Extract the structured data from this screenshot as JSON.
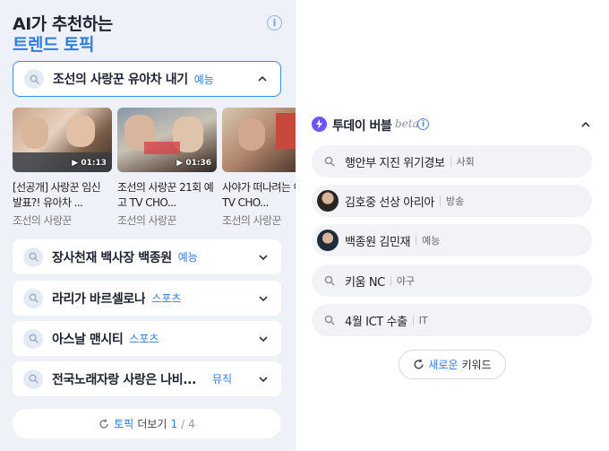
{
  "left": {
    "title_line1": "AI가 추천하는",
    "title_line2": "트렌드 토픽",
    "info_icon": "info-icon",
    "open_topic": {
      "title": "조선의 사랑꾼 유아차 내기",
      "category": "예능"
    },
    "videos": [
      {
        "duration": "01:13",
        "title": "[선공개] 사랑꾼 임신 발표?! 유아차 ...",
        "source": "조선의 사랑꾼"
      },
      {
        "duration": "01:36",
        "title": "조선의 사랑꾼 21회 예고 TV CHO...",
        "source": "조선의 사랑꾼"
      },
      {
        "duration": "",
        "title": "사야가 떠나려는 이유 TV CHO...",
        "source": "조선의 사랑꾼"
      }
    ],
    "topics": [
      {
        "title": "장사천재 백사장 백종원",
        "category": "예능"
      },
      {
        "title": "라리가 바르셀로나",
        "category": "스포츠"
      },
      {
        "title": "아스날 맨시티",
        "category": "스포츠"
      },
      {
        "title": "전국노래자랑 사랑은 나비...",
        "category": "뮤직"
      }
    ],
    "more": {
      "topic_label": "토픽",
      "more_label": "더보기",
      "page_current": "1",
      "page_sep": "/",
      "page_total": "4"
    }
  },
  "right": {
    "title": "투데이 버블",
    "beta": "beta",
    "keywords": [
      {
        "keyword": "행안부 지진 위기경보",
        "category": "사회",
        "icon": "search-icon"
      },
      {
        "keyword": "김호중 선상 아리아",
        "category": "방송",
        "icon": "avatar"
      },
      {
        "keyword": "백종원 김민재",
        "category": "예능",
        "icon": "avatar"
      },
      {
        "keyword": "키움 NC",
        "category": "야구",
        "icon": "search-icon"
      },
      {
        "keyword": "4월 ICT 수출",
        "category": "IT",
        "icon": "search-icon"
      }
    ],
    "new_keyword": {
      "blue": "새로운",
      "dark": "키워드"
    }
  },
  "colors": {
    "accent": "#2f7de1",
    "panel_bg": "#eef2f8",
    "bubble_purple": "#6b57f5"
  }
}
